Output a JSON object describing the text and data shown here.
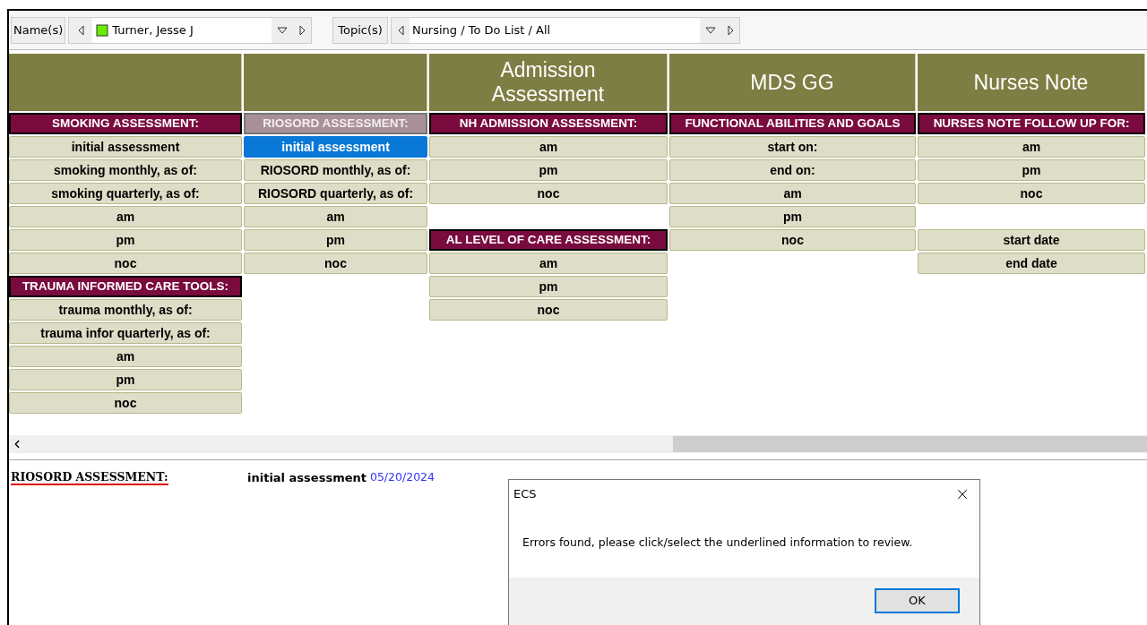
{
  "toolbar": {
    "names_button": "Name(s)",
    "name_value": "Turner, Jesse J",
    "topics_button": "Topic(s)",
    "topic_value": "Nursing / To Do List / All"
  },
  "columns": [
    {
      "items": [
        {
          "kind": "section",
          "label": "SMOKING ASSESSMENT:",
          "selected": false
        },
        {
          "kind": "item",
          "label": "initial assessment",
          "selected": false
        },
        {
          "kind": "item",
          "label": "smoking monthly, as of:",
          "selected": false
        },
        {
          "kind": "item",
          "label": "smoking quarterly, as of:",
          "selected": false
        },
        {
          "kind": "item",
          "label": "am",
          "selected": false
        },
        {
          "kind": "item",
          "label": "pm",
          "selected": false
        },
        {
          "kind": "item",
          "label": "noc",
          "selected": false
        },
        {
          "kind": "section",
          "label": "TRAUMA INFORMED CARE TOOLS:",
          "selected": false
        },
        {
          "kind": "item",
          "label": "trauma monthly, as of:",
          "selected": false
        },
        {
          "kind": "item",
          "label": "trauma infor quarterly, as of:",
          "selected": false
        },
        {
          "kind": "item",
          "label": "am",
          "selected": false
        },
        {
          "kind": "item",
          "label": "pm",
          "selected": false
        },
        {
          "kind": "item",
          "label": "noc",
          "selected": false
        }
      ]
    },
    {
      "items": [
        {
          "kind": "section",
          "label": "RIOSORD ASSESSMENT:",
          "selected": true
        },
        {
          "kind": "item",
          "label": "initial assessment",
          "selected": true
        },
        {
          "kind": "item",
          "label": "RIOSORD monthly, as of:",
          "selected": false
        },
        {
          "kind": "item",
          "label": "RIOSORD quarterly, as of:",
          "selected": false
        },
        {
          "kind": "item",
          "label": "am",
          "selected": false
        },
        {
          "kind": "item",
          "label": "pm",
          "selected": false
        },
        {
          "kind": "item",
          "label": "noc",
          "selected": false
        }
      ]
    },
    {
      "title": "Admission Assessment",
      "items": [
        {
          "kind": "section",
          "label": "NH ADMISSION ASSESSMENT:",
          "selected": false
        },
        {
          "kind": "item",
          "label": "am",
          "selected": false
        },
        {
          "kind": "item",
          "label": "pm",
          "selected": false
        },
        {
          "kind": "item",
          "label": "noc",
          "selected": false
        },
        {
          "kind": "blank"
        },
        {
          "kind": "section",
          "label": "AL LEVEL OF CARE ASSESSMENT:",
          "selected": false
        },
        {
          "kind": "item",
          "label": "am",
          "selected": false
        },
        {
          "kind": "item",
          "label": "pm",
          "selected": false
        },
        {
          "kind": "item",
          "label": "noc",
          "selected": false
        }
      ]
    },
    {
      "title": "MDS GG",
      "items": [
        {
          "kind": "section",
          "label": "FUNCTIONAL ABILITIES AND GOALS",
          "selected": false
        },
        {
          "kind": "item",
          "label": "start on:",
          "selected": false
        },
        {
          "kind": "item",
          "label": "end on:",
          "selected": false
        },
        {
          "kind": "item",
          "label": "am",
          "selected": false
        },
        {
          "kind": "item",
          "label": "pm",
          "selected": false
        },
        {
          "kind": "item",
          "label": "noc",
          "selected": false
        }
      ]
    },
    {
      "title": "Nurses Note",
      "items": [
        {
          "kind": "section",
          "label": "NURSES NOTE FOLLOW UP FOR:",
          "selected": false
        },
        {
          "kind": "item",
          "label": "am",
          "selected": false
        },
        {
          "kind": "item",
          "label": "pm",
          "selected": false
        },
        {
          "kind": "item",
          "label": "noc",
          "selected": false
        },
        {
          "kind": "blank"
        },
        {
          "kind": "item",
          "label": "start date",
          "selected": false
        },
        {
          "kind": "item",
          "label": "end date",
          "selected": false
        }
      ]
    }
  ],
  "detail": {
    "section_link": "RIOSORD ASSESSMENT:",
    "item": "initial assessment",
    "date": "05/20/2024"
  },
  "dialog": {
    "title": "ECS",
    "message": "Errors found, please click/select the underlined information to review.",
    "ok_button": "OK"
  }
}
